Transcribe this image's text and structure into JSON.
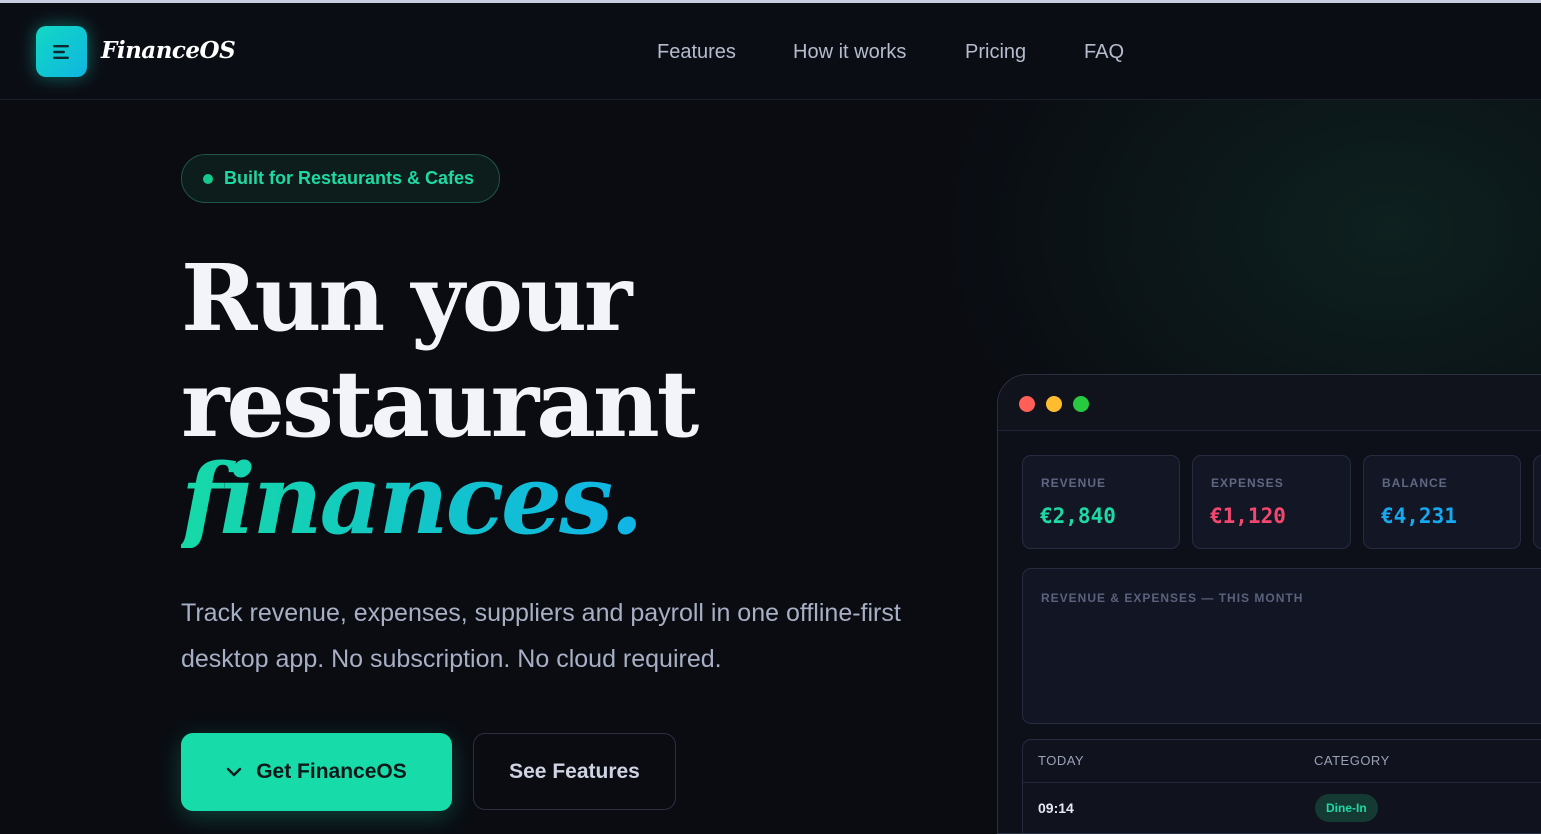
{
  "brand": {
    "name": "FinanceOS"
  },
  "nav": {
    "items": [
      "Features",
      "How it works",
      "Pricing",
      "FAQ"
    ]
  },
  "hero": {
    "badge": "Built for Restaurants & Cafes",
    "title_line1": "Run your",
    "title_line2": "restaurant",
    "title_accent": "finances.",
    "subtitle": "Track revenue, expenses, suppliers and payroll in one offline-first desktop app. No subscription. No cloud required.",
    "primary_button": "Get FinanceOS",
    "secondary_button": "See Features"
  },
  "app_preview": {
    "cards": [
      {
        "label": "REVENUE",
        "value": "€2,840",
        "color": "#1ed9a4"
      },
      {
        "label": "EXPENSES",
        "value": "€1,120",
        "color": "#f2476e"
      },
      {
        "label": "BALANCE",
        "value": "€4,231",
        "color": "#16a9f0"
      }
    ],
    "chart_title": "REVENUE & EXPENSES — THIS MONTH",
    "table": {
      "headers": [
        "TODAY",
        "CATEGORY"
      ],
      "rows": [
        {
          "time": "09:14",
          "category": "Dine-In"
        }
      ]
    }
  },
  "colors": {
    "accent": "#17dcaa",
    "accent_blue": "#10b4e8",
    "background": "#0a0c12"
  }
}
